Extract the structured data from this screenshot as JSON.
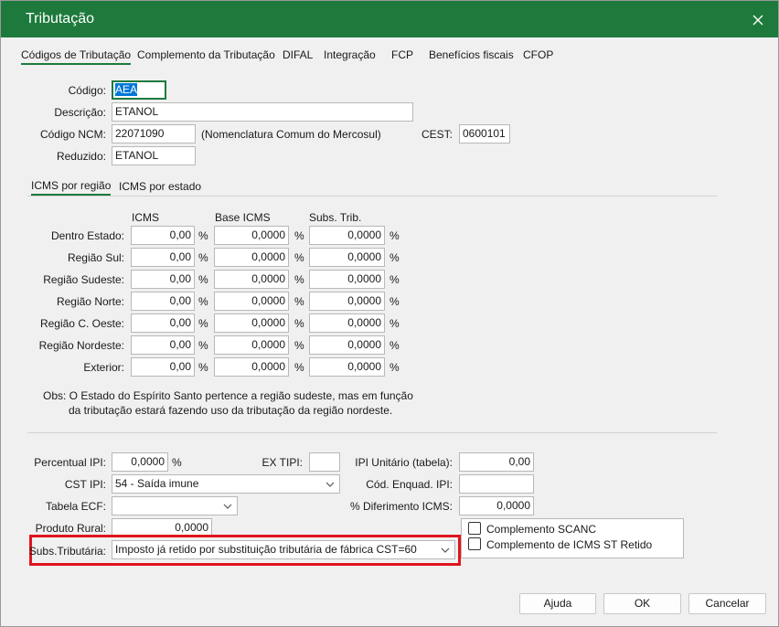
{
  "window": {
    "title": "Tributação"
  },
  "top_tabs": [
    "Códigos de Tributação",
    "Complemento da Tributação",
    "DIFAL",
    "Integração",
    "FCP",
    "Benefícios fiscais",
    "CFOP"
  ],
  "form": {
    "codigo_label": "Código:",
    "codigo_value": "AEA",
    "descricao_label": "Descrição:",
    "descricao_value": "ETANOL",
    "ncm_label": "Código NCM:",
    "ncm_value": "22071090",
    "ncm_note": "(Nomenclatura Comum do Mercosul)",
    "cest_label": "CEST:",
    "cest_value": "0600101",
    "reduzido_label": "Reduzido:",
    "reduzido_value": "ETANOL"
  },
  "icms_tabs": [
    "ICMS por região",
    "ICMS por estado"
  ],
  "icms_table": {
    "headers": [
      "ICMS",
      "Base ICMS",
      "Subs. Trib."
    ],
    "pct": "%",
    "rows": [
      {
        "label": "Dentro Estado:",
        "icms": "0,00",
        "base": "0,0000",
        "subs": "0,0000"
      },
      {
        "label": "Região Sul:",
        "icms": "0,00",
        "base": "0,0000",
        "subs": "0,0000"
      },
      {
        "label": "Região Sudeste:",
        "icms": "0,00",
        "base": "0,0000",
        "subs": "0,0000"
      },
      {
        "label": "Região Norte:",
        "icms": "0,00",
        "base": "0,0000",
        "subs": "0,0000"
      },
      {
        "label": "Região C. Oeste:",
        "icms": "0,00",
        "base": "0,0000",
        "subs": "0,0000"
      },
      {
        "label": "Região Nordeste:",
        "icms": "0,00",
        "base": "0,0000",
        "subs": "0,0000"
      },
      {
        "label": "Exterior:",
        "icms": "0,00",
        "base": "0,0000",
        "subs": "0,0000"
      }
    ]
  },
  "obs": {
    "line1": "Obs: O Estado do Espírito Santo pertence a região sudeste, mas em função",
    "line2": "da tributação estará fazendo uso da tributação da região nordeste."
  },
  "ipi": {
    "percentual_label": "Percentual IPI:",
    "percentual_value": "0,0000",
    "percentual_pct": "%",
    "ex_tipi_label": "EX TIPI:",
    "ex_tipi_value": "",
    "ipi_unitario_label": "IPI Unitário (tabela):",
    "ipi_unitario_value": "0,00",
    "cst_label": "CST IPI:",
    "cst_value": "54 - Saída imune",
    "cod_enquad_label": "Cód. Enquad. IPI:",
    "cod_enquad_value": "",
    "tabela_ecf_label": "Tabela ECF:",
    "tabela_ecf_value": "",
    "diferimento_label": "% Diferimento ICMS:",
    "diferimento_value": "0,0000",
    "produto_rural_label": "Produto Rural:",
    "produto_rural_value": "0,0000",
    "subs_label": "Subs.Tributária:",
    "subs_value": "Imposto já retido por substituição tributária de fábrica CST=60",
    "comp_scanc_label": "Complemento SCANC",
    "comp_icms_st_label": "Complemento de ICMS ST Retido"
  },
  "buttons": {
    "ajuda": "Ajuda",
    "ok": "OK",
    "cancelar": "Cancelar"
  },
  "colors": {
    "title_bar": "#1d7a3c",
    "accent": "#1d7a3c",
    "highlight": "#e0141e"
  }
}
